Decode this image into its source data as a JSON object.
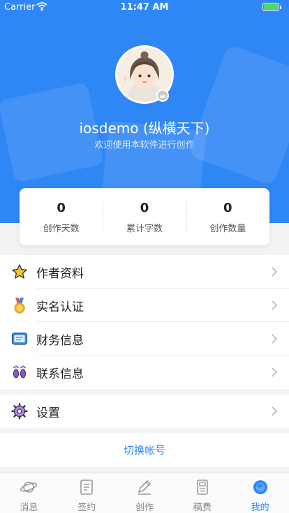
{
  "status_bar": {
    "carrier": "Carrier",
    "time": "11:47 AM"
  },
  "profile": {
    "username": "iosdemo (纵横天下)",
    "tagline": "欢迎使用本软件进行创作"
  },
  "stats": [
    {
      "value": "0",
      "label": "创作天数"
    },
    {
      "value": "0",
      "label": "累计字数"
    },
    {
      "value": "0",
      "label": "创作数量"
    }
  ],
  "menu": [
    {
      "label": "作者资料",
      "icon": "star-icon"
    },
    {
      "label": "实名认证",
      "icon": "medal-icon"
    },
    {
      "label": "财务信息",
      "icon": "card-icon"
    },
    {
      "label": "联系信息",
      "icon": "footprints-icon"
    }
  ],
  "settings": {
    "label": "设置",
    "icon": "gear-icon"
  },
  "switch_account": "切换帐号",
  "tabs": [
    {
      "label": "消息",
      "icon": "planet-icon",
      "active": false
    },
    {
      "label": "签约",
      "icon": "contract-icon",
      "active": false
    },
    {
      "label": "创作",
      "icon": "pencil-icon",
      "active": false
    },
    {
      "label": "稿费",
      "icon": "manuscript-icon",
      "active": false
    },
    {
      "label": "我的",
      "icon": "globe-icon",
      "active": true
    }
  ],
  "colors": {
    "primary": "#2f86f5",
    "background": "#f2f3f5",
    "text": "#222222"
  }
}
